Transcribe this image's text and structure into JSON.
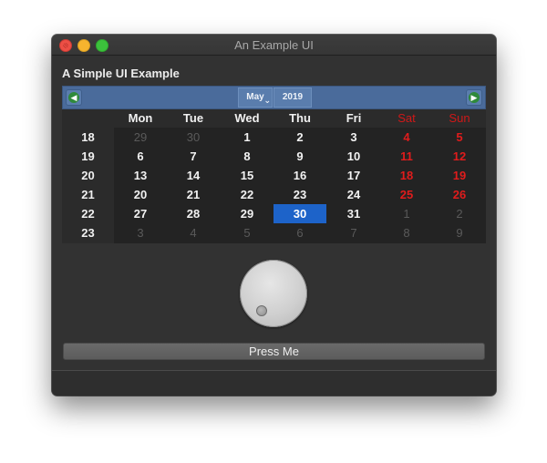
{
  "window": {
    "title": "An Example UI"
  },
  "heading": "A Simple UI Example",
  "calendar": {
    "month": "May",
    "year": "2019",
    "day_headers": [
      "Mon",
      "Tue",
      "Wed",
      "Thu",
      "Fri",
      "Sat",
      "Sun"
    ],
    "weeks": [
      {
        "week": "18",
        "days": [
          {
            "d": "29",
            "dim": true
          },
          {
            "d": "30",
            "dim": true
          },
          {
            "d": "1"
          },
          {
            "d": "2"
          },
          {
            "d": "3"
          },
          {
            "d": "4"
          },
          {
            "d": "5"
          }
        ]
      },
      {
        "week": "19",
        "days": [
          {
            "d": "6"
          },
          {
            "d": "7"
          },
          {
            "d": "8"
          },
          {
            "d": "9"
          },
          {
            "d": "10"
          },
          {
            "d": "11"
          },
          {
            "d": "12"
          }
        ]
      },
      {
        "week": "20",
        "days": [
          {
            "d": "13"
          },
          {
            "d": "14"
          },
          {
            "d": "15"
          },
          {
            "d": "16"
          },
          {
            "d": "17"
          },
          {
            "d": "18"
          },
          {
            "d": "19"
          }
        ]
      },
      {
        "week": "21",
        "days": [
          {
            "d": "20"
          },
          {
            "d": "21"
          },
          {
            "d": "22"
          },
          {
            "d": "23"
          },
          {
            "d": "24"
          },
          {
            "d": "25"
          },
          {
            "d": "26"
          }
        ]
      },
      {
        "week": "22",
        "days": [
          {
            "d": "27"
          },
          {
            "d": "28"
          },
          {
            "d": "29"
          },
          {
            "d": "30",
            "selected": true
          },
          {
            "d": "31"
          },
          {
            "d": "1",
            "dim": true
          },
          {
            "d": "2",
            "dim": true
          }
        ]
      },
      {
        "week": "23",
        "days": [
          {
            "d": "3",
            "dim": true
          },
          {
            "d": "4",
            "dim": true
          },
          {
            "d": "5",
            "dim": true
          },
          {
            "d": "6",
            "dim": true
          },
          {
            "d": "7",
            "dim": true
          },
          {
            "d": "8",
            "dim": true
          },
          {
            "d": "9",
            "dim": true
          }
        ]
      }
    ],
    "selected_date": "30",
    "weekend_color": "#e01c1c",
    "selected_color": "#1d63c9",
    "nav_color": "#4a6b9b",
    "prev_icon": "arrow-left-icon",
    "next_icon": "arrow-right-icon"
  },
  "dial": {
    "icon": "dial-knob"
  },
  "button": {
    "label": "Press Me"
  }
}
